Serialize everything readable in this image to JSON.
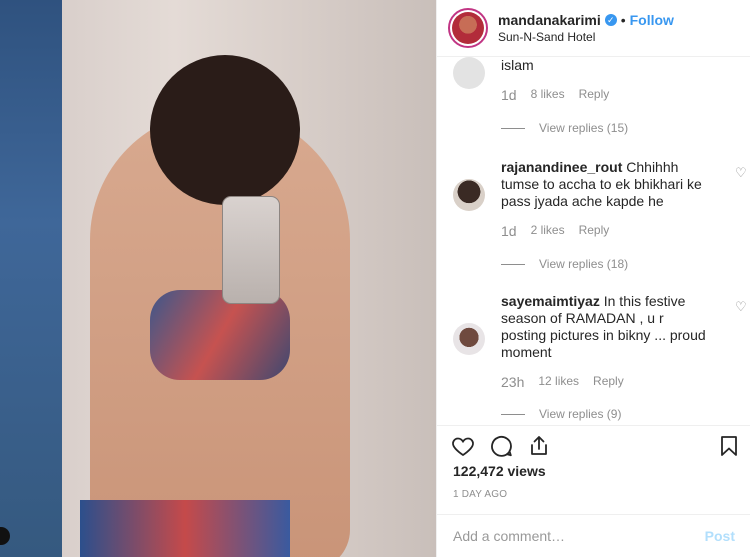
{
  "post": {
    "username": "mandanakarimi",
    "follow_label": "Follow",
    "dot": "•",
    "location": "Sun-N-Sand Hotel",
    "verified_icon": "verified-badge-icon"
  },
  "comments": [
    {
      "text": "islam",
      "time": "1d",
      "likes": "8 likes",
      "reply": "Reply",
      "view_replies": "View replies (15)"
    },
    {
      "handle": "rajanandinee_rout",
      "text": "Chhihhh tumse to accha to ek bhikhari ke pass jyada ache kapde he",
      "time": "1d",
      "likes": "2 likes",
      "reply": "Reply",
      "view_replies": "View replies (18)"
    },
    {
      "handle": "sayemaimtiyaz",
      "text": "In this festive season of RAMADAN , u r posting pictures in bikny ... proud moment",
      "time": "23h",
      "likes": "12 likes",
      "reply": "Reply",
      "view_replies": "View replies (9)"
    }
  ],
  "stats": {
    "views": "122,472 views",
    "date": "1 DAY AGO"
  },
  "add_comment": {
    "placeholder": "Add a comment…",
    "post_label": "Post"
  },
  "colors": {
    "accent": "#3897f0",
    "post_disabled": "#b2dffc",
    "muted": "#8e8e8e"
  }
}
